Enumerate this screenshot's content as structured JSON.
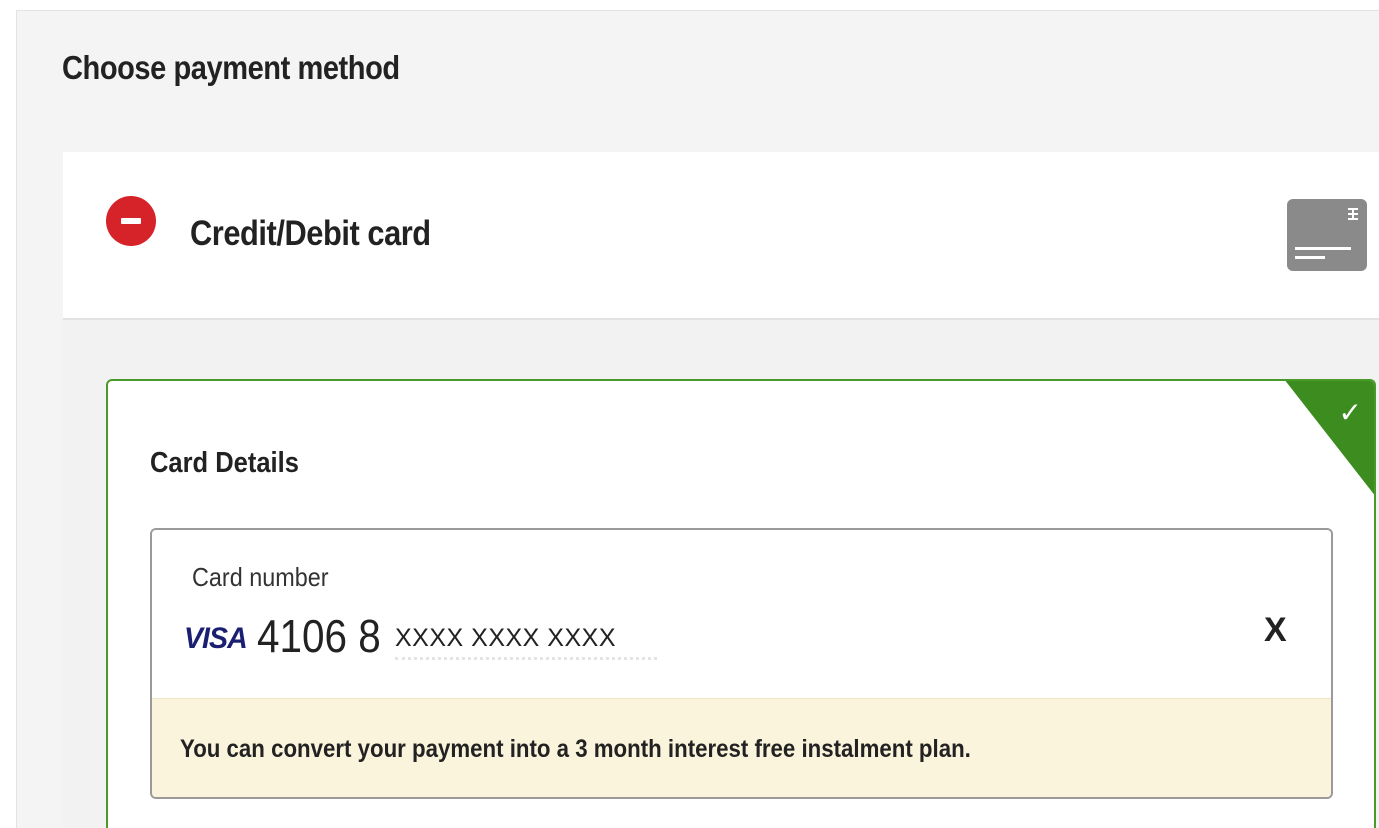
{
  "page": {
    "title": "Choose payment method"
  },
  "payment_method": {
    "label": "Credit/Debit card",
    "collapse_icon": "minus-circle-icon",
    "method_icon": "credit-card-icon",
    "accent_color": "#d6232a",
    "selected": true
  },
  "card_details": {
    "heading": "Card Details",
    "selected_indicator_icon": "checkmark-icon",
    "selected_color": "#3d8c1f",
    "card_number": {
      "label": "Card number",
      "brand": "VISA",
      "visible_digits": "4106 8",
      "masked_digits": "XXXX XXXX XXXX",
      "clear_icon": "close-icon",
      "clear_label": "X"
    },
    "notice": "You can convert your payment into a 3 month interest free instalment plan."
  }
}
